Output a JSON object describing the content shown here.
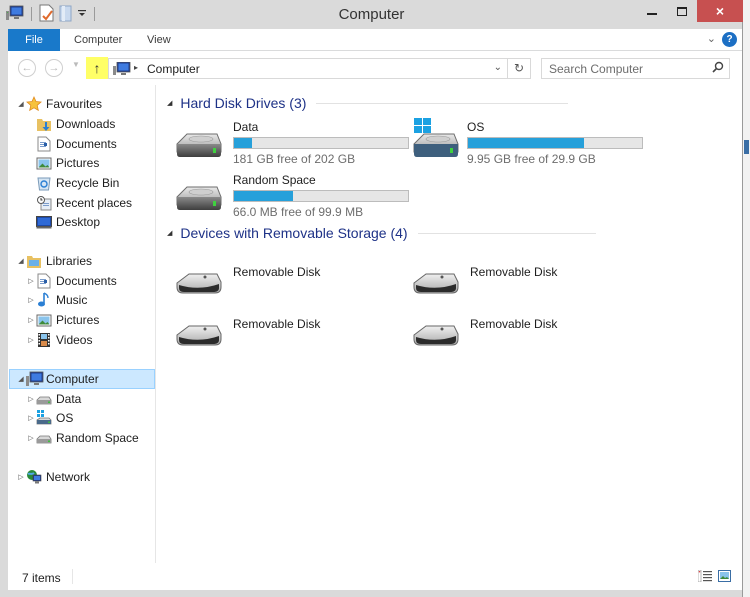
{
  "window": {
    "title": "Computer",
    "controls": {
      "minimize": "minimize",
      "maximize": "maximize",
      "close": "×"
    }
  },
  "quick_access_toolbar": {
    "icons": [
      "computer-icon",
      "properties-icon",
      "new-folder-icon",
      "customize-dropdown-icon"
    ]
  },
  "ribbon": {
    "tabs": [
      {
        "label": "File",
        "active": true
      },
      {
        "label": "Computer"
      },
      {
        "label": "View"
      }
    ],
    "expand_glyph": "⌄",
    "help_glyph": "?"
  },
  "navigation": {
    "back_glyph": "←",
    "forward_glyph": "→",
    "recent_glyph": "▼",
    "up_glyph": "↑",
    "breadcrumb": [
      "Computer"
    ],
    "breadcrumb_sep": "▸",
    "address_dropdown_glyph": "⌄",
    "refresh_glyph": "↻",
    "search_placeholder": "Search Computer",
    "search_value": ""
  },
  "nav_pane": {
    "favourites": {
      "label": "Favourites",
      "expanded": true,
      "items": [
        {
          "label": "Downloads",
          "icon": "downloads-icon"
        },
        {
          "label": "Documents",
          "icon": "documents-icon"
        },
        {
          "label": "Pictures",
          "icon": "pictures-icon"
        },
        {
          "label": "Recycle Bin",
          "icon": "recycle-bin-icon"
        },
        {
          "label": "Recent places",
          "icon": "recent-places-icon"
        },
        {
          "label": "Desktop",
          "icon": "desktop-icon"
        }
      ]
    },
    "libraries": {
      "label": "Libraries",
      "expanded": true,
      "items": [
        {
          "label": "Documents",
          "icon": "documents-icon"
        },
        {
          "label": "Music",
          "icon": "music-icon"
        },
        {
          "label": "Pictures",
          "icon": "pictures-icon"
        },
        {
          "label": "Videos",
          "icon": "videos-icon"
        }
      ]
    },
    "computer": {
      "label": "Computer",
      "expanded": true,
      "selected": true,
      "items": [
        {
          "label": "Data",
          "icon": "drive-icon"
        },
        {
          "label": "OS",
          "icon": "os-drive-icon"
        },
        {
          "label": "Random Space",
          "icon": "drive-icon"
        }
      ]
    },
    "network": {
      "label": "Network",
      "expanded": false
    }
  },
  "content": {
    "hard_disk_drives": {
      "header": "Hard Disk Drives (3)",
      "drives": [
        {
          "name": "Data",
          "free_text": "181 GB free of 202 GB",
          "used_fraction": 0.104
        },
        {
          "name": "OS",
          "free_text": "9.95 GB free of 29.9 GB",
          "used_fraction": 0.667
        },
        {
          "name": "Random Space",
          "free_text": "66.0 MB free of 99.9 MB",
          "used_fraction": 0.339
        }
      ]
    },
    "removable_storage": {
      "header": "Devices with Removable Storage (4)",
      "devices": [
        {
          "name": "Removable Disk"
        },
        {
          "name": "Removable Disk"
        },
        {
          "name": "Removable Disk"
        },
        {
          "name": "Removable Disk"
        }
      ]
    }
  },
  "status_bar": {
    "item_count": "7 items"
  },
  "colors": {
    "accent": "#1979ca",
    "progress_fill": "#26a0da",
    "group_header": "#1e3287",
    "selection_bg": "#cce8ff",
    "close_button": "#c75050",
    "up_highlight": "#ffff66"
  }
}
